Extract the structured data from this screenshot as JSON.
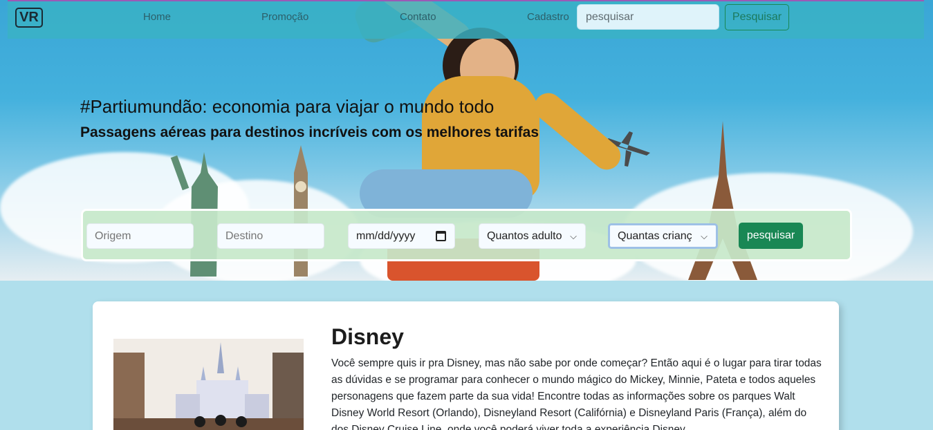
{
  "nav": {
    "logo": "VR",
    "links": [
      "Home",
      "Promoção",
      "Contato",
      "Cadastro"
    ],
    "search_placeholder": "pesquisar",
    "search_button": "Pesquisar"
  },
  "hero": {
    "title": "#Partiumundão: economia para viajar o mundo todo",
    "subtitle": "Passagens aéreas para destinos incríveis com os melhores tarifas"
  },
  "search": {
    "origin_placeholder": "Origem",
    "destination_placeholder": "Destino",
    "date_placeholder": "mm/dd/yyyy",
    "adults_select": "Quantos adulto",
    "children_select": "Quantas crianç",
    "button": "pesquisar"
  },
  "card": {
    "title": "Disney",
    "text": "Você sempre quis ir pra Disney, mas não sabe por onde começar? Então aqui é o lugar para tirar todas as dúvidas e se programar para conhecer o mundo mágico do Mickey, Minnie, Pateta e todos aqueles personagens que fazem parte da sua vida! Encontre todas as informações sobre os parques Walt Disney World Resort (Orlando), Disneyland Resort (Califórnia) e Disneyland Paris (França), além do dos Disney Cruise Line, onde você poderá viver toda a experiência Disney"
  }
}
